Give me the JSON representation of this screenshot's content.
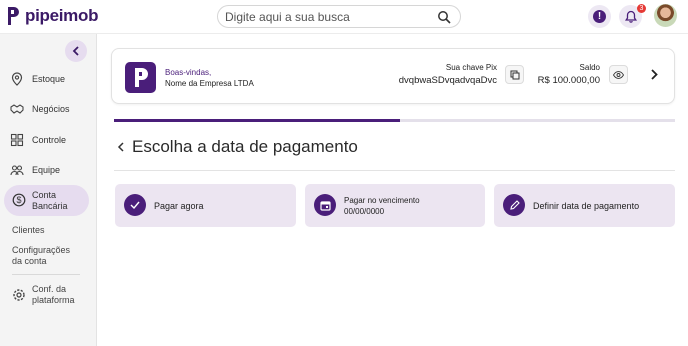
{
  "header": {
    "brand": "pipeimob",
    "search_placeholder": "Digite aqui a sua busca",
    "notification_count": "3",
    "alert_symbol": "!"
  },
  "sidebar": {
    "items": [
      {
        "label": "Estoque",
        "icon": "map-pin-icon"
      },
      {
        "label": "Negócios",
        "icon": "handshake-icon"
      },
      {
        "label": "Controle",
        "icon": "grid-icon"
      },
      {
        "label": "Equipe",
        "icon": "people-icon"
      }
    ],
    "active": {
      "label_line1": "Conta",
      "label_line2": "Bancária",
      "icon": "dollar-icon"
    },
    "sub_items": [
      {
        "label": "Clientes"
      },
      {
        "label_line1": "Configurações",
        "label_line2": "da conta"
      }
    ],
    "platform": {
      "label_line1": "Conf. da",
      "label_line2": "plataforma",
      "icon": "gear-icon"
    }
  },
  "welcome": {
    "greeting": "Boas-vindas,",
    "company": "Nome da Empresa LTDA",
    "pix_label": "Sua chave Pix",
    "pix_value": "dvqbwaSDvqadvqaDvc",
    "balance_label": "Saldo",
    "balance_value": "R$ 100.000,00"
  },
  "progress": {
    "fraction": 0.51
  },
  "page": {
    "title": "Escolha a data de pagamento"
  },
  "options": [
    {
      "label": "Pagar agora",
      "sub": "",
      "icon": "check-icon"
    },
    {
      "label": "Pagar no vencimento",
      "sub": "00/00/0000",
      "icon": "calendar-icon"
    },
    {
      "label": "Definir data de pagamento",
      "sub": "",
      "icon": "pencil-icon"
    }
  ],
  "colors": {
    "accent": "#4a1e7a",
    "accent_light": "#ece5f1",
    "active_nav": "#e6dcef"
  }
}
